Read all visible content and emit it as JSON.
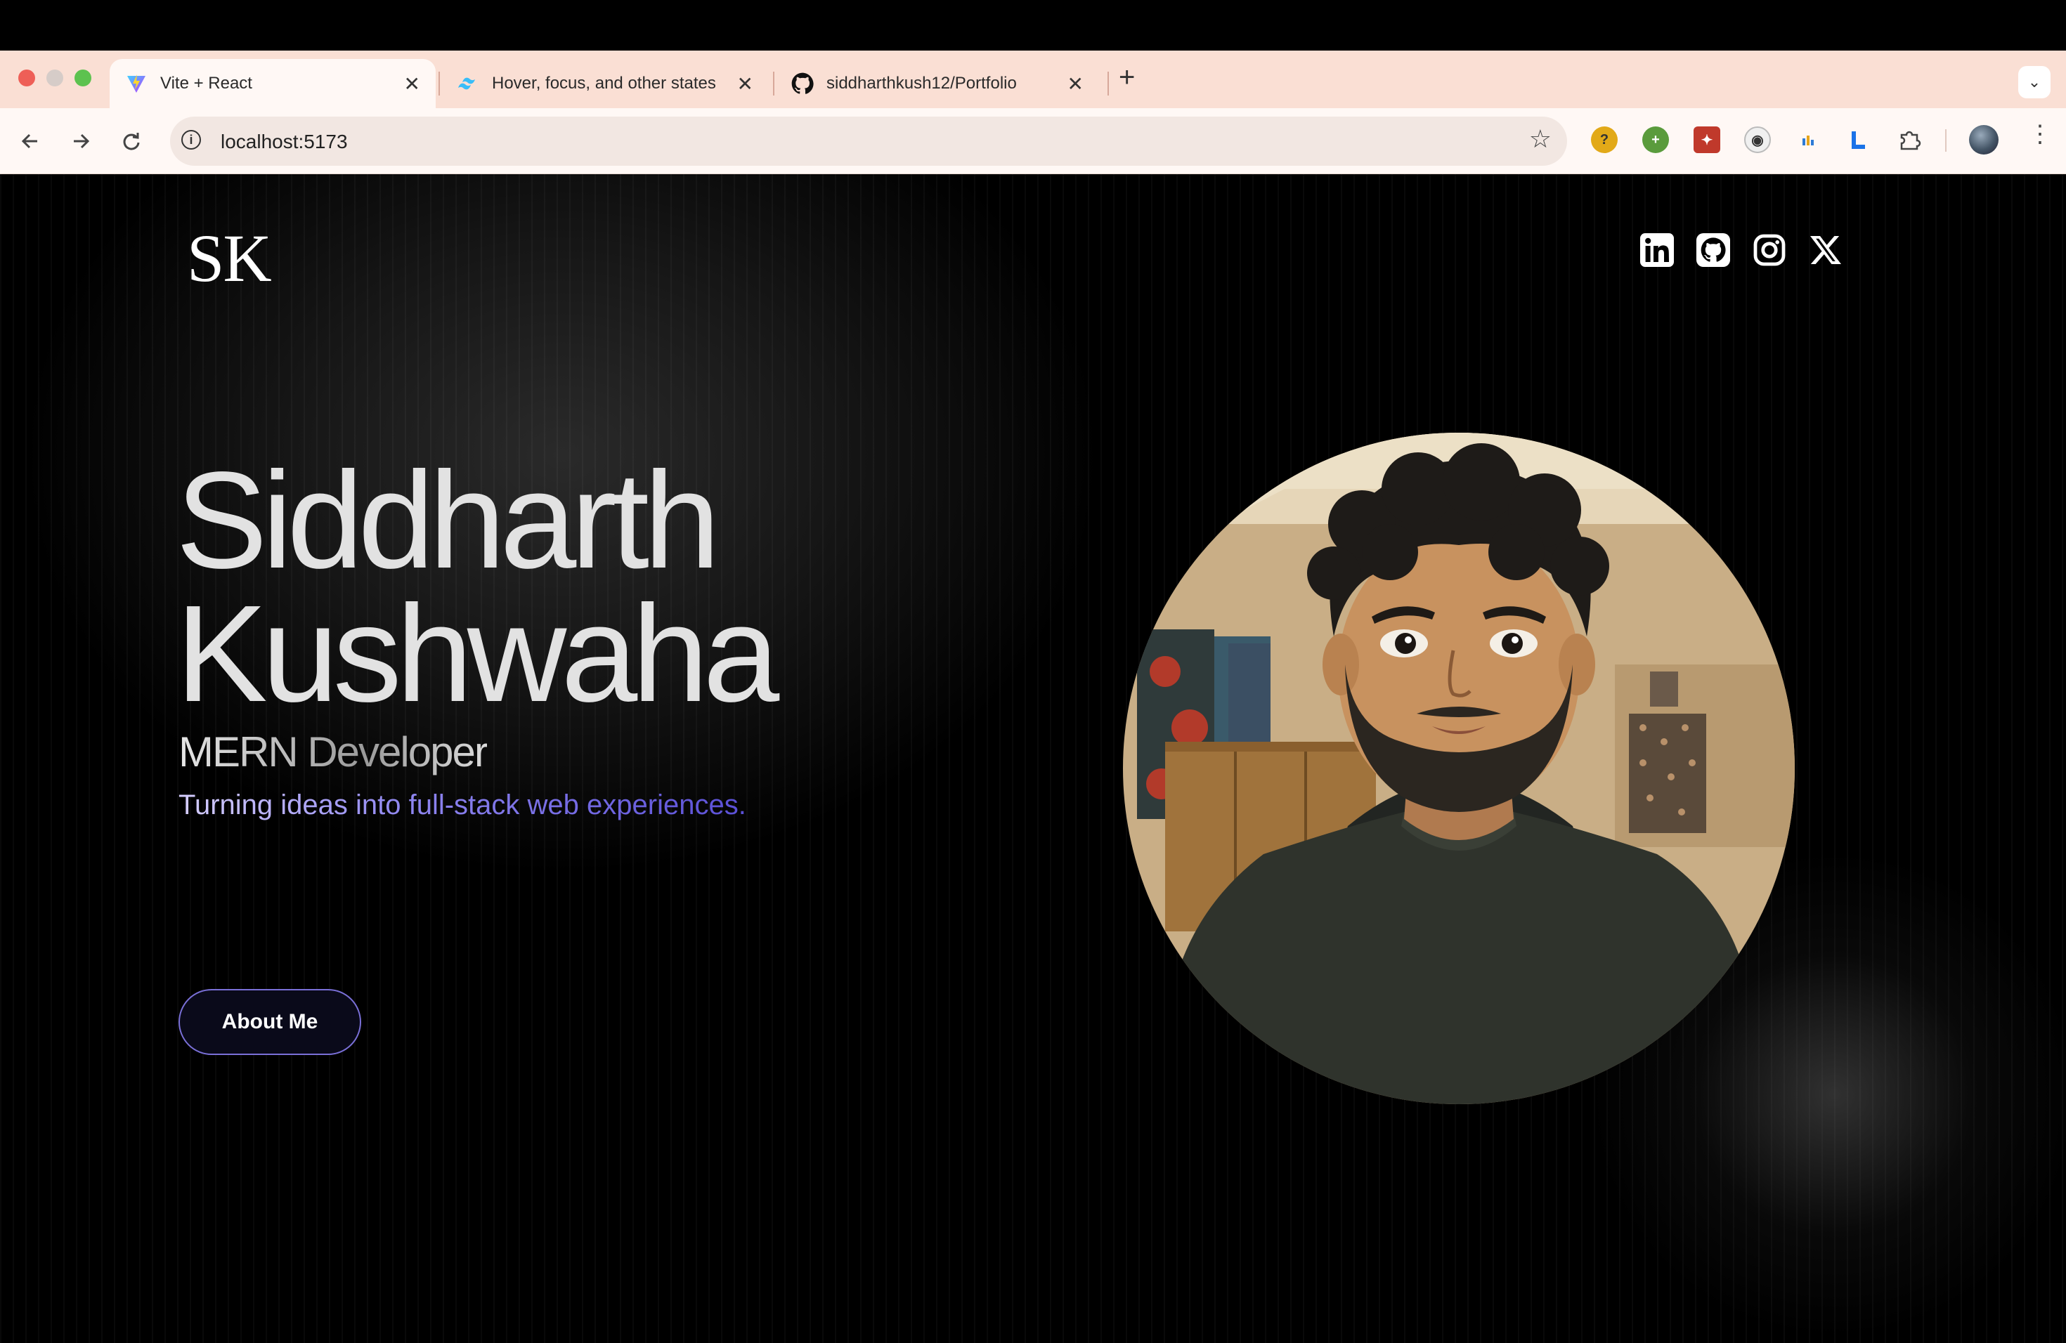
{
  "browser": {
    "tabs": [
      {
        "title": "Vite + React",
        "icon": "vite-icon",
        "active": true
      },
      {
        "title": "Hover, focus, and other states",
        "icon": "tailwind-icon",
        "active": false
      },
      {
        "title": "siddharthkush12/Portfolio",
        "icon": "github-icon",
        "active": false
      }
    ],
    "url": "localhost:5173",
    "extensions": [
      "yellow-ext-icon",
      "green-plus-ext-icon",
      "red-ext-icon",
      "panda-ext-icon",
      "bar-chart-ext-icon",
      "l-ext-icon",
      "puzzle-icon"
    ]
  },
  "site": {
    "logo": "SK",
    "socials": [
      "linkedin-icon",
      "github-icon",
      "instagram-icon",
      "x-icon"
    ],
    "hero": {
      "first_name": "Siddharth",
      "last_name": "Kushwaha",
      "role": "MERN Developer",
      "tagline": "Turning ideas into full-stack web experiences.",
      "cta": "About Me"
    }
  },
  "colors": {
    "tabstrip": "#fadfd4",
    "toolbar": "#fff8f5",
    "page_bg": "#000000",
    "accent": "#7a70d8"
  }
}
